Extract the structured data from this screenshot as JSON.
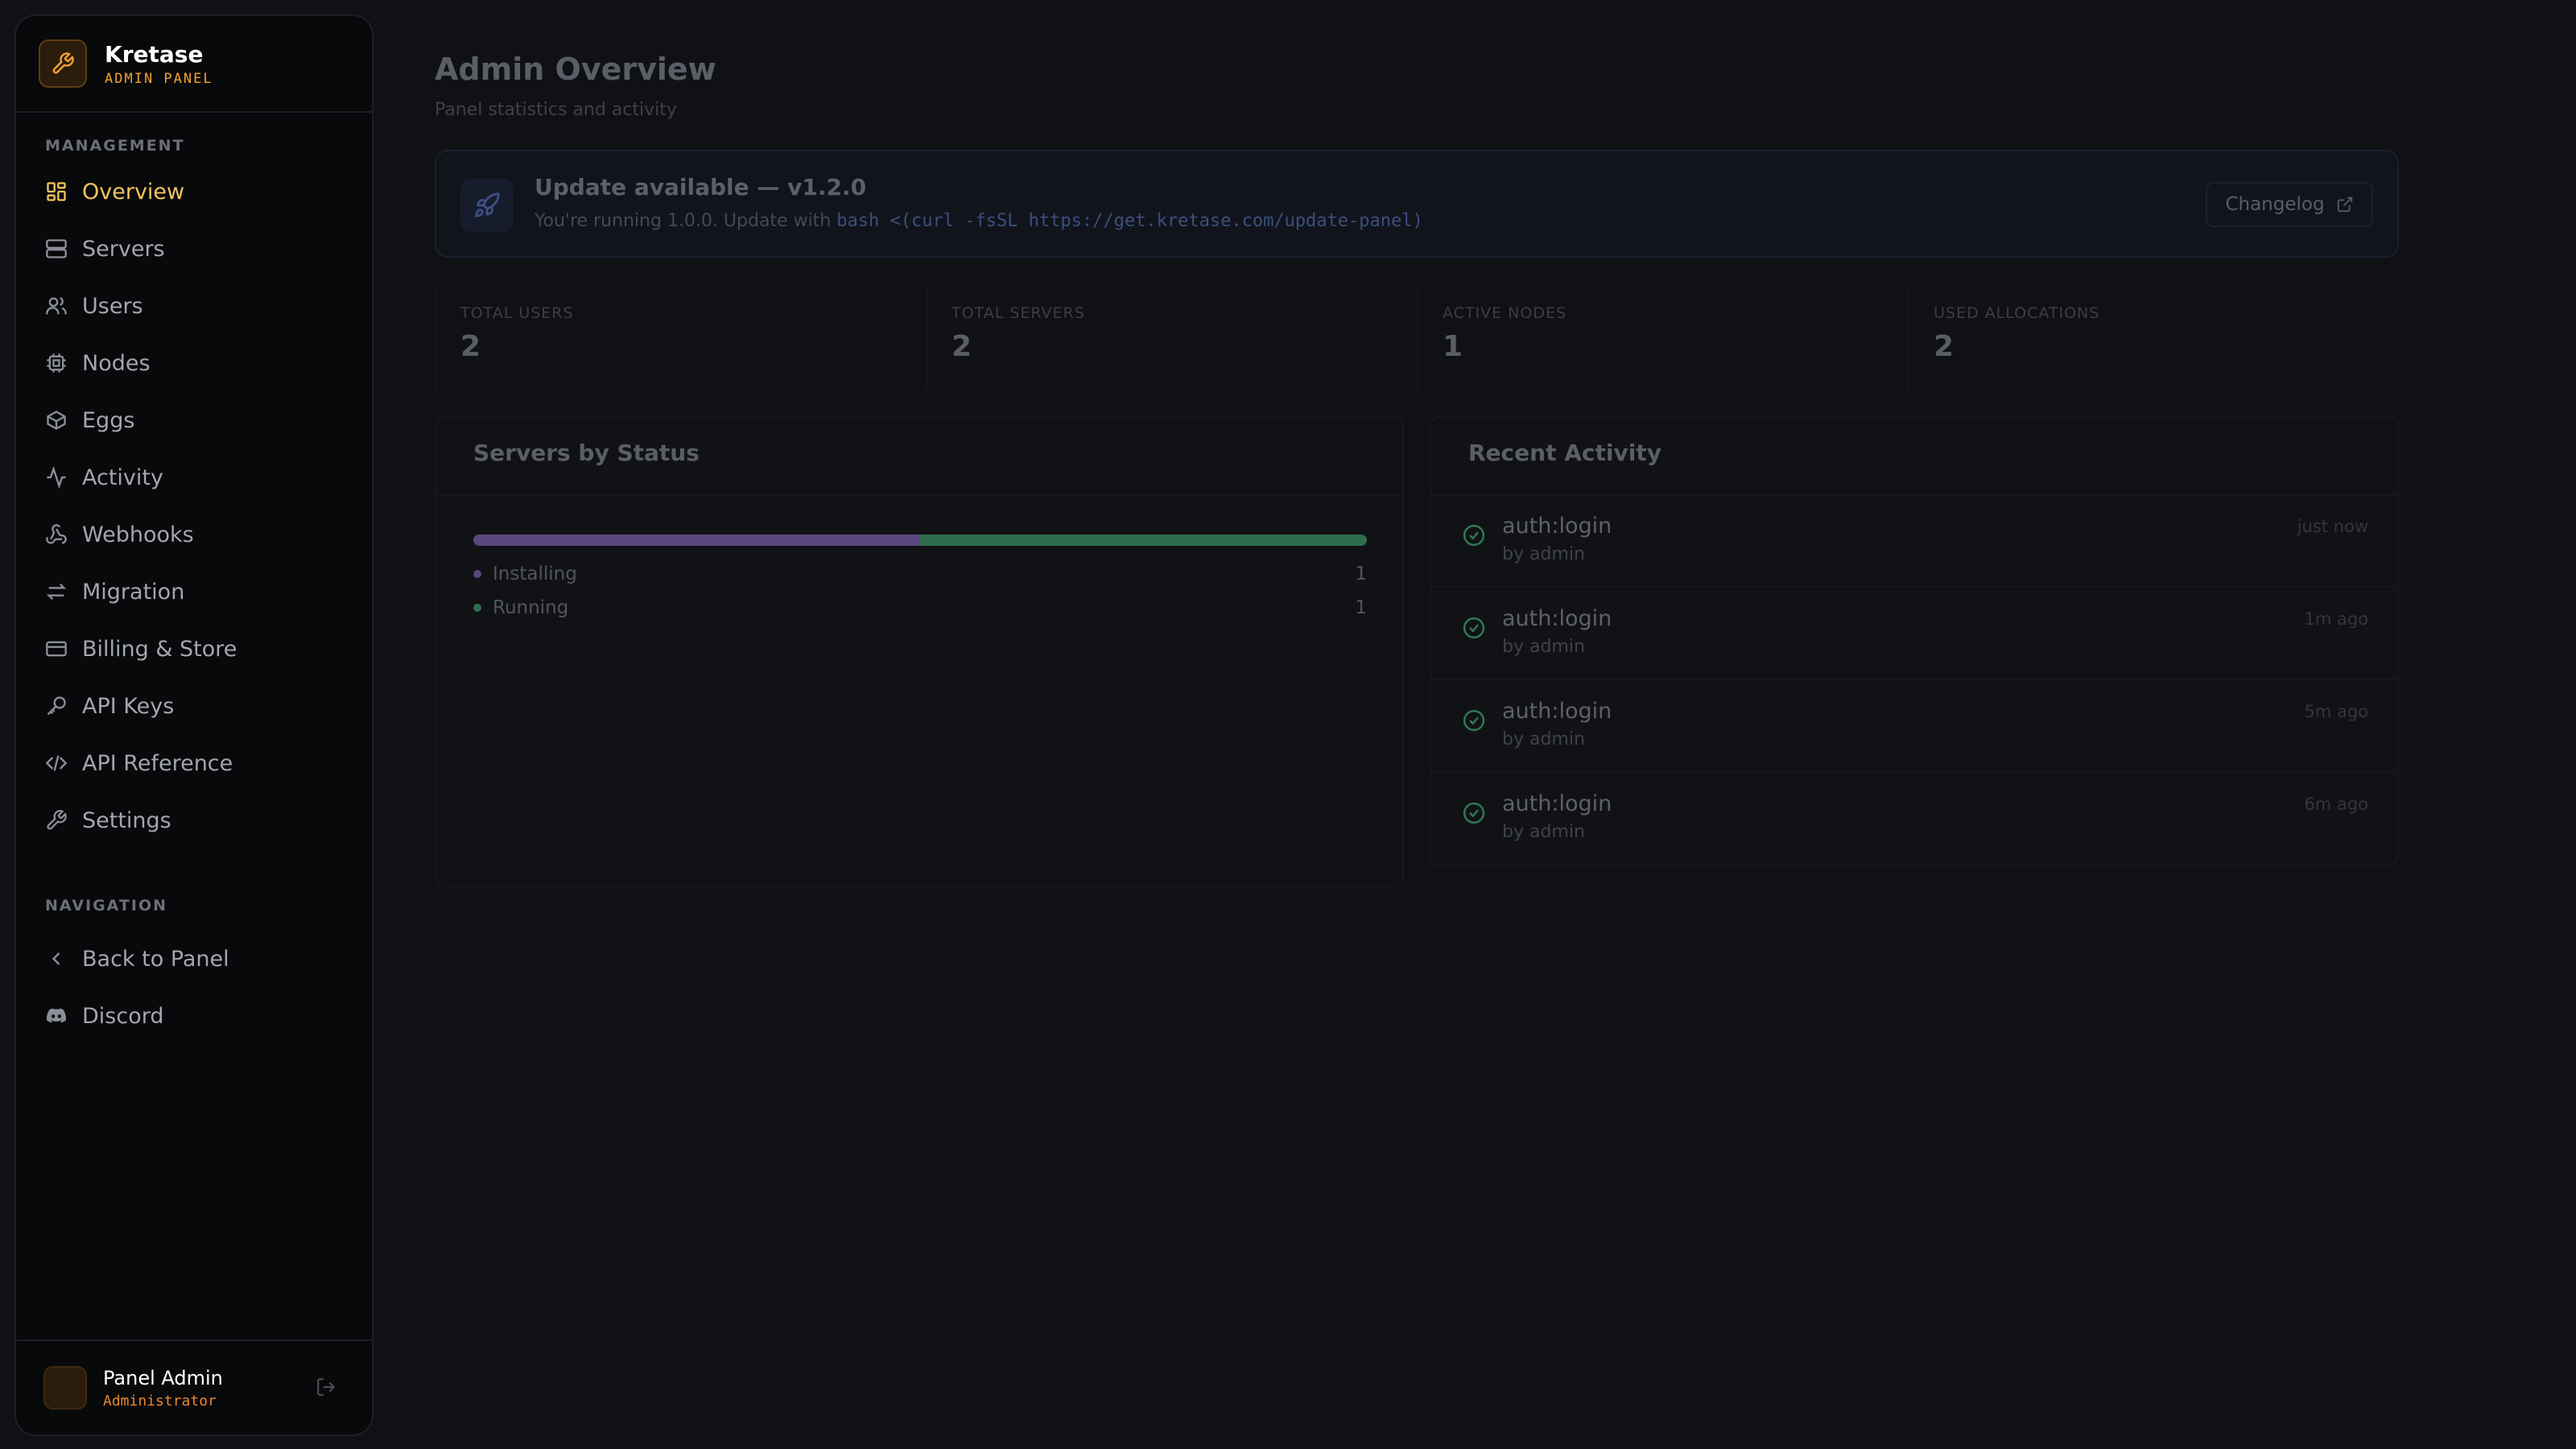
{
  "brand": {
    "name": "Kretase",
    "subtitle": "ADMIN PANEL",
    "icon": "wrench-icon",
    "accent": "#f0a030"
  },
  "sidebar": {
    "management_heading": "MANAGEMENT",
    "items": [
      {
        "label": "Overview",
        "icon": "grid-icon",
        "active": true
      },
      {
        "label": "Servers",
        "icon": "server-icon"
      },
      {
        "label": "Users",
        "icon": "users-icon"
      },
      {
        "label": "Nodes",
        "icon": "cpu-icon"
      },
      {
        "label": "Eggs",
        "icon": "package-icon"
      },
      {
        "label": "Activity",
        "icon": "activity-icon"
      },
      {
        "label": "Webhooks",
        "icon": "webhook-icon"
      },
      {
        "label": "Migration",
        "icon": "arrows-swap-icon"
      },
      {
        "label": "Billing & Store",
        "icon": "credit-card-icon"
      },
      {
        "label": "API Keys",
        "icon": "key-icon"
      },
      {
        "label": "API Reference",
        "icon": "code-icon"
      },
      {
        "label": "Settings",
        "icon": "wrench-icon"
      }
    ],
    "navigation_heading": "NAVIGATION",
    "nav_items": [
      {
        "label": "Back to Panel",
        "icon": "chevron-left-icon"
      },
      {
        "label": "Discord",
        "icon": "discord-icon"
      }
    ],
    "user": {
      "name": "Panel Admin",
      "role": "Administrator",
      "logout_icon": "logout-icon"
    }
  },
  "header": {
    "title": "Admin Overview",
    "subtitle": "Panel statistics and activity"
  },
  "update": {
    "title": "Update available — v1.2.0",
    "text": "You're running 1.0.0. Update with",
    "command": "bash <(curl -fsSL https://get.kretase.com/update-panel)",
    "button": "Changelog",
    "icon": "rocket-icon"
  },
  "stats": [
    {
      "label": "TOTAL USERS",
      "value": "2"
    },
    {
      "label": "TOTAL SERVERS",
      "value": "2"
    },
    {
      "label": "ACTIVE NODES",
      "value": "1"
    },
    {
      "label": "USED ALLOCATIONS",
      "value": "2"
    }
  ],
  "servers_by_status": {
    "title": "Servers by Status",
    "statuses": [
      {
        "label": "Installing",
        "count": "1",
        "color": "#5a477e"
      },
      {
        "label": "Running",
        "count": "1",
        "color": "#2f6d4c"
      }
    ]
  },
  "recent_activity": {
    "title": "Recent Activity",
    "items": [
      {
        "event": "auth:login",
        "by": "by admin",
        "time": "just now"
      },
      {
        "event": "auth:login",
        "by": "by admin",
        "time": "1m ago"
      },
      {
        "event": "auth:login",
        "by": "by admin",
        "time": "5m ago"
      },
      {
        "event": "auth:login",
        "by": "by admin",
        "time": "6m ago"
      }
    ]
  }
}
